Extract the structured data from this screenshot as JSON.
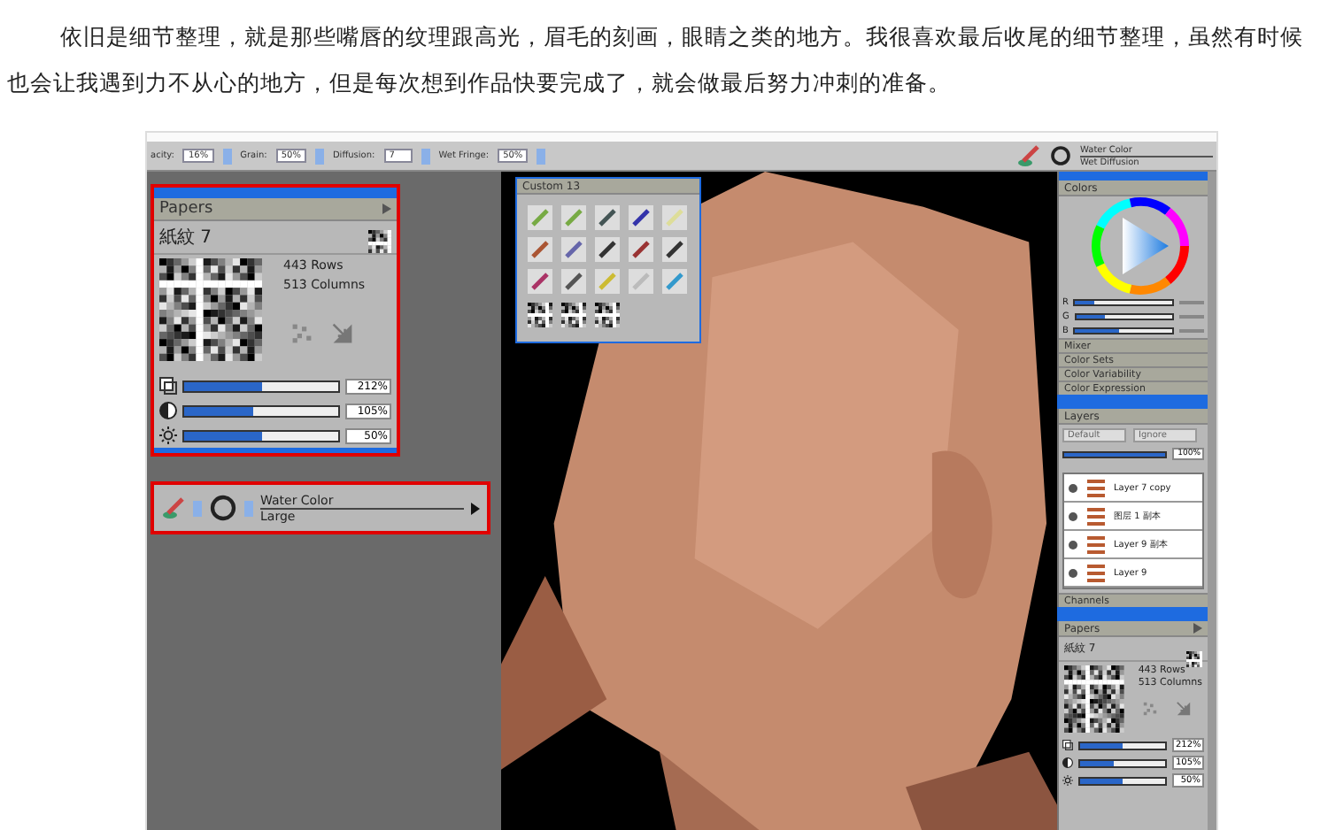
{
  "article": {
    "paragraph": "依旧是细节整理，就是那些嘴唇的纹理跟高光，眉毛的刻画，眼睛之类的地方。我很喜欢最后收尾的细节整理，虽然有时候也会让我遇到力不从心的地方，但是每次想到作品快要完成了，就会做最后努力冲刺的准备。"
  },
  "toolbar": {
    "fields": [
      {
        "label": "acity:",
        "value": "16%"
      },
      {
        "label": "Grain:",
        "value": "50%"
      },
      {
        "label": "Diffusion:",
        "value": "7"
      },
      {
        "label": "Wet Fringe:",
        "value": "50%"
      }
    ],
    "brush": {
      "category": "Water Color",
      "variant": "Wet Diffusion"
    }
  },
  "papers_panel": {
    "title": "Papers",
    "paper_name": "紙紋 7",
    "rows": "443 Rows",
    "columns": "513 Columns",
    "sliders": [
      {
        "kind": "scale",
        "level": 0.5,
        "reading": "212%"
      },
      {
        "kind": "contrast",
        "level": 0.45,
        "reading": "105%"
      },
      {
        "kind": "brightness",
        "level": 0.5,
        "reading": "50%"
      }
    ]
  },
  "brush_selector": {
    "category": "Water Color",
    "variant": "Large"
  },
  "custom_palette": {
    "title": "Custom 13"
  },
  "colors_panel": {
    "title": "Colors",
    "sliders": [
      {
        "label": "R",
        "level": 0.2
      },
      {
        "label": "G",
        "level": 0.3
      },
      {
        "label": "B",
        "level": 0.45
      }
    ],
    "sections": [
      "Mixer",
      "Color Sets",
      "Color Variability",
      "Color Expression"
    ]
  },
  "layers_panel": {
    "title": "Layers",
    "composite_method": "Default",
    "composite_depth": "Ignore",
    "opacity": "100%",
    "opacity_slider": {
      "level": 1
    },
    "layers": [
      {
        "name": "Layer 7 copy"
      },
      {
        "name": "图层 1 副本"
      },
      {
        "name": "Layer 9 副本"
      },
      {
        "name": "Layer 9"
      }
    ],
    "channels_title": "Channels"
  },
  "papers_dock": {
    "title": "Papers",
    "paper_name": "紙紋 7",
    "rows": "443 Rows",
    "columns": "513 Columns",
    "sliders": [
      {
        "kind": "scale",
        "level": 0.5,
        "reading": "212%"
      },
      {
        "kind": "contrast",
        "level": 0.4,
        "reading": "105%"
      },
      {
        "kind": "brightness",
        "level": 0.5,
        "reading": "50%"
      }
    ]
  }
}
